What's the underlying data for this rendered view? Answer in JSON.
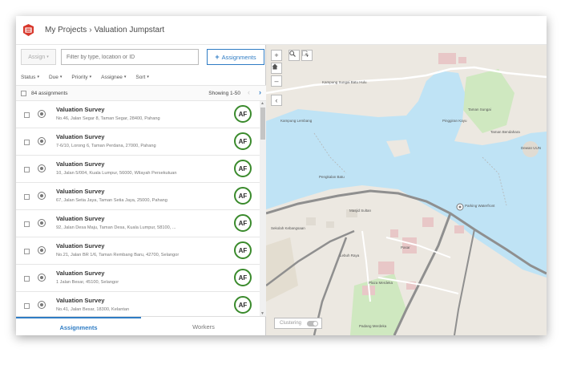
{
  "breadcrumb": {
    "root": "My Projects",
    "separator": "›",
    "current": "Valuation Jumpstart"
  },
  "toolbar": {
    "assign_label": "Assign",
    "filter_placeholder": "Filter by type, location or ID",
    "add_label": "Assignments"
  },
  "filters": [
    "Status",
    "Due",
    "Priority",
    "Assignee",
    "Sort"
  ],
  "list_header": {
    "count": "84 assignments",
    "showing": "Showing 1-50"
  },
  "assignments": [
    {
      "title": "Valuation Survey",
      "address": "No.46, Jalan Segar 8, Taman Segar, 28400, Pahang",
      "assignee": "AF"
    },
    {
      "title": "Valuation Survey",
      "address": "7-6/10, Lorong 6, Taman Perdana, 27000, Pahang",
      "assignee": "AF"
    },
    {
      "title": "Valuation Survey",
      "address": "10, Jalan 5/004, Kuala Lumpur, 56000, Wilayah Persekutuan",
      "assignee": "AF"
    },
    {
      "title": "Valuation Survey",
      "address": "67, Jalan Setia Jaya, Taman Setia Jaya, 25000, Pahang",
      "assignee": "AF"
    },
    {
      "title": "Valuation Survey",
      "address": "92, Jalan Desa Maju, Taman Desa, Kuala Lumpur, 58100, ...",
      "assignee": "AF"
    },
    {
      "title": "Valuation Survey",
      "address": "No.21, Jalan BR 1/6, Taman Rembang Baru, 42700, Selangor",
      "assignee": "AF"
    },
    {
      "title": "Valuation Survey",
      "address": "1 Jalan Besar, 45100, Selangor",
      "assignee": "AF"
    },
    {
      "title": "Valuation Survey",
      "address": "No.41, Jalan Besar, 18300, Kelantan",
      "assignee": "AF"
    }
  ],
  "tabs": {
    "assignments": "Assignments",
    "workers": "Workers"
  },
  "map": {
    "labels": {
      "road_top": "Kampung Sungai Batu Hulu",
      "taman": "Taman Sungai",
      "kampung": "Kampung Lembang",
      "pinggiran": "Pinggiran Kayu",
      "pengkalan": "Pengkalan Batu",
      "taman2": "Taman Bendahara",
      "masjid": "Masjid Sultan",
      "sekolah": "Sekolah Kebangsaan",
      "lebuh": "Lebuh Raya",
      "pasar": "Pasar",
      "plaza": "Plaza Merdeka",
      "padang": "Padang Merdeka",
      "parking": "Parking Waterfront",
      "dewan": "Dewan UUN"
    },
    "clustering_label": "Clustering"
  },
  "colors": {
    "accent": "#2f7cc4",
    "assignee_ring": "#3a8a2c",
    "water": "#bfe3f5",
    "park": "#cfe8c0"
  }
}
